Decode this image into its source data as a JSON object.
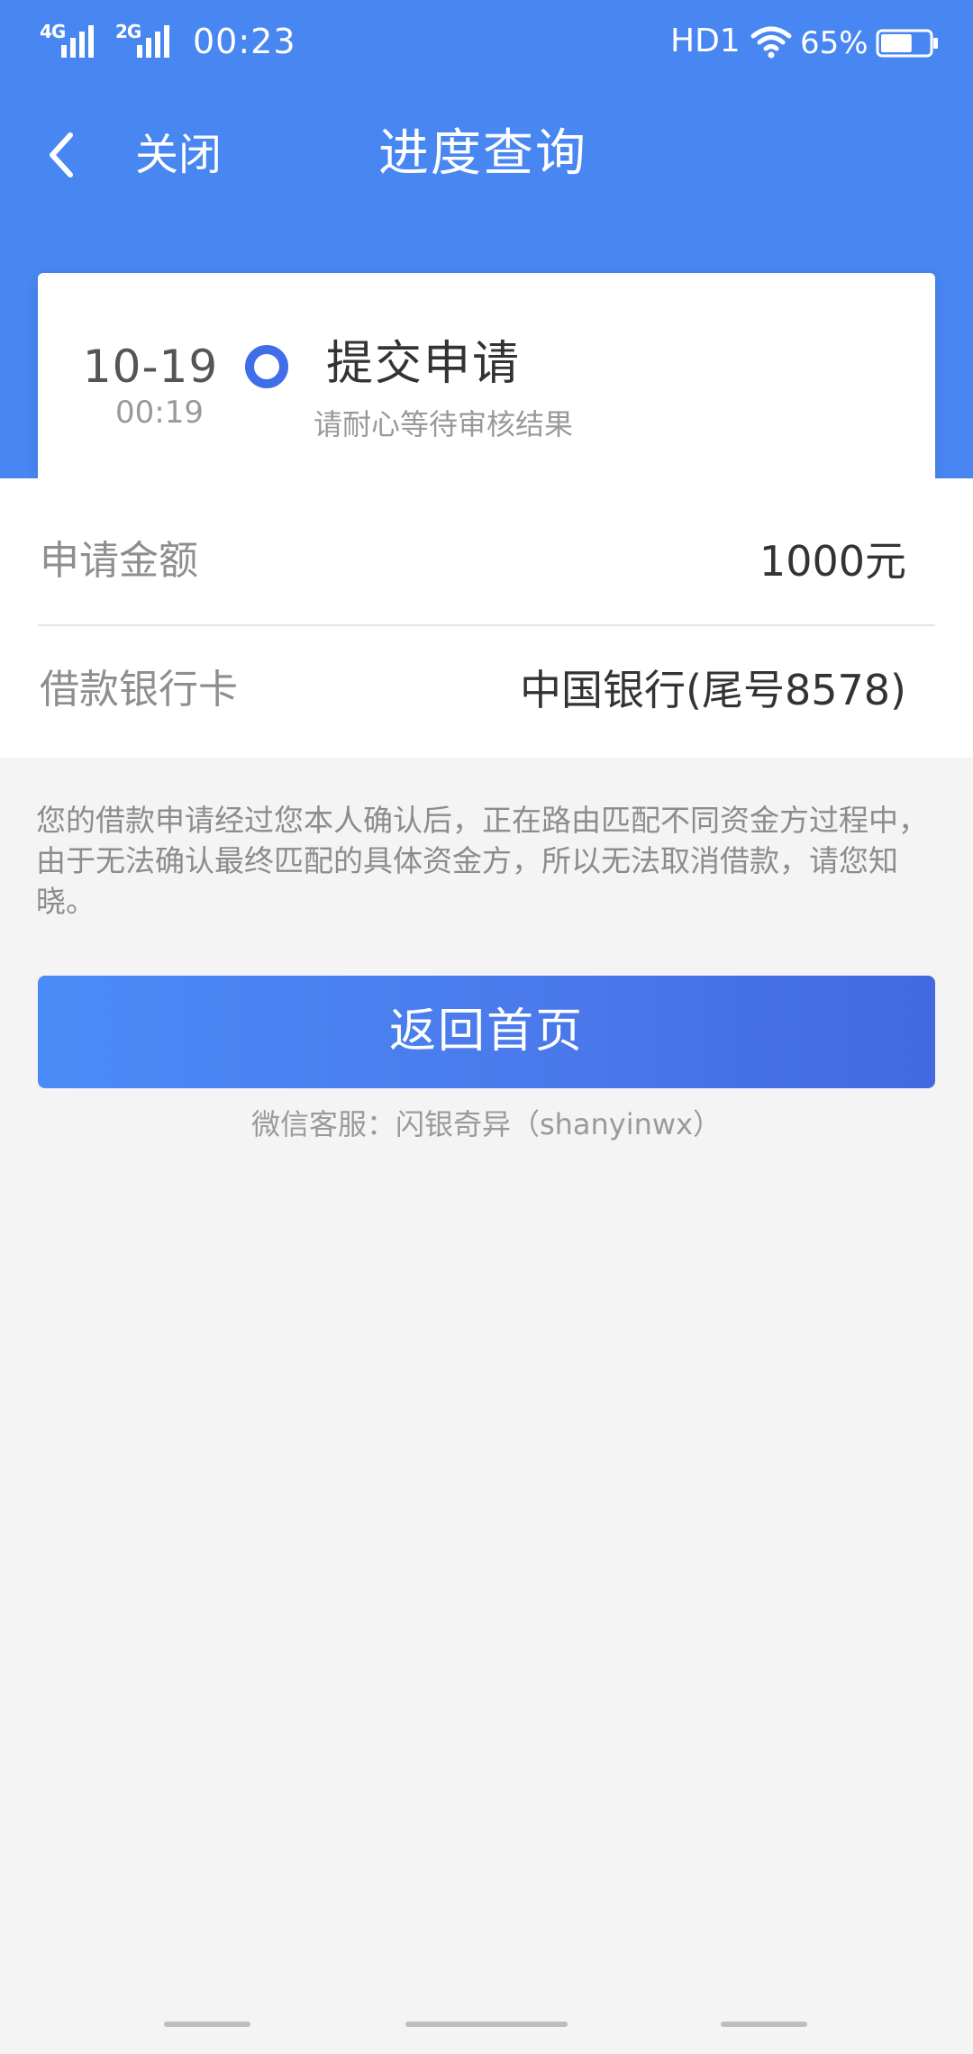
{
  "status_bar": {
    "signal1_tag": "4G",
    "signal2_tag": "2G",
    "time": "00:23",
    "hd_label": "HD1",
    "battery_percent": "65%",
    "battery_level": 0.65
  },
  "nav": {
    "close_label": "关闭",
    "title": "进度查询"
  },
  "progress": {
    "date": "10-19",
    "time": "00:19",
    "step_title": "提交申请",
    "step_subtitle": "请耐心等待审核结果"
  },
  "details": {
    "amount_label": "申请金额",
    "amount_value": "1000元",
    "card_label": "借款银行卡",
    "card_value": "中国银行(尾号8578)"
  },
  "notice": "您的借款申请经过您本人确认后，正在路由匹配不同资金方过程中，由于无法确认最终匹配的具体资金方，所以无法取消借款，请您知晓。",
  "button": {
    "home_label": "返回首页"
  },
  "customer_service": "微信客服：闪银奇异（shanyinwx）",
  "colors": {
    "header": "#4886f1",
    "accent": "#3f6ee8",
    "background": "#f4f4f4"
  }
}
